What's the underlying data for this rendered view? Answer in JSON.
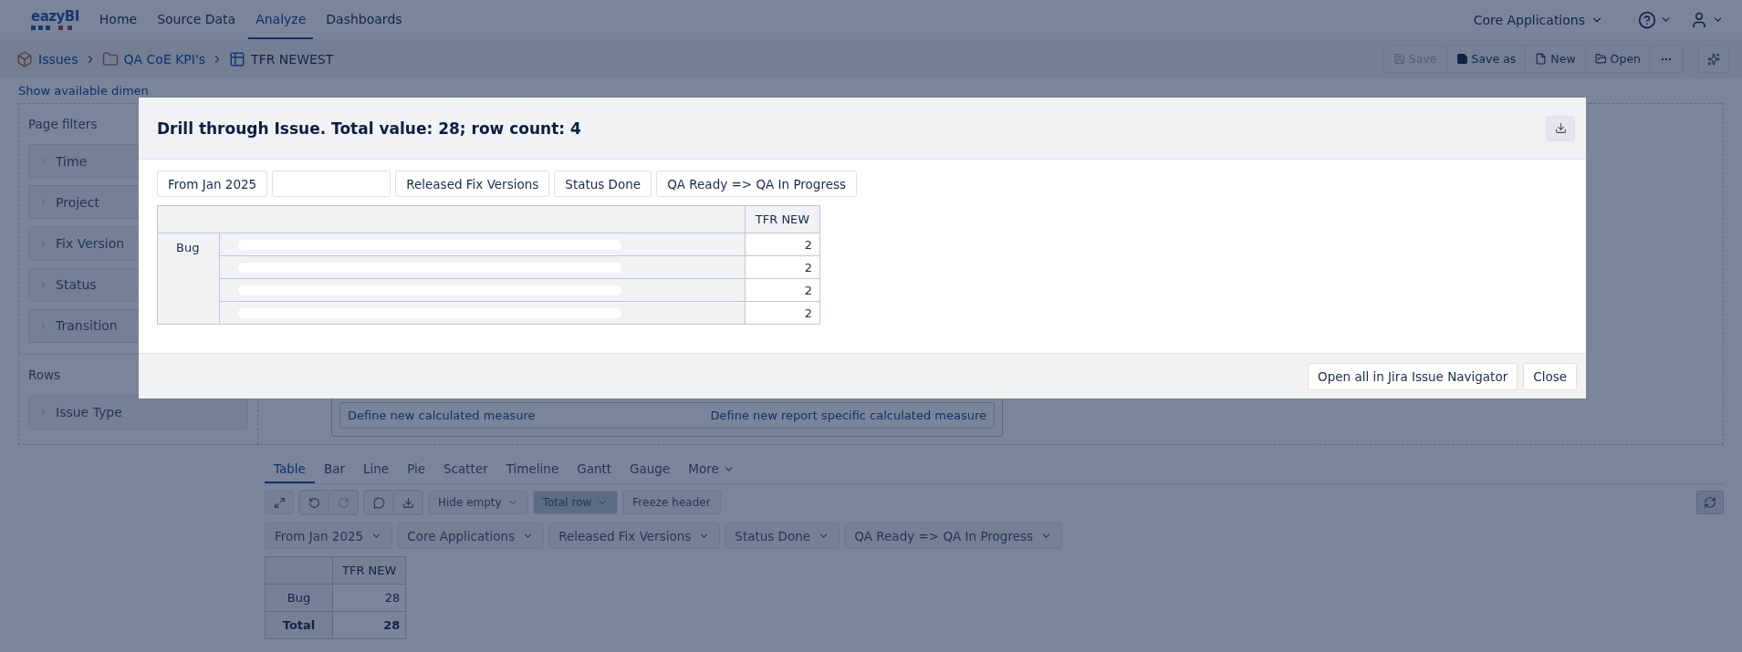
{
  "logo": {
    "text": "eazyBI"
  },
  "nav": [
    {
      "label": "Home",
      "selected": false
    },
    {
      "label": "Source Data",
      "selected": false
    },
    {
      "label": "Analyze",
      "selected": true
    },
    {
      "label": "Dashboards",
      "selected": false
    }
  ],
  "account": {
    "label": "Core Applications"
  },
  "breadcrumb": [
    {
      "label": "Issues",
      "kind": "cube",
      "link": true
    },
    {
      "label": "QA CoE KPI's",
      "kind": "folder",
      "link": true
    },
    {
      "label": "TFR NEWEST",
      "kind": "table",
      "link": false
    }
  ],
  "report_actions": [
    {
      "label": "Save",
      "kind": "save",
      "disabled": true
    },
    {
      "label": "Save as",
      "kind": "saveas",
      "disabled": false
    },
    {
      "label": "New",
      "kind": "new",
      "disabled": false
    },
    {
      "label": "Open",
      "kind": "open",
      "disabled": false
    }
  ],
  "dimensions_link": "Show available dimen",
  "page_filters": {
    "title": "Page filters",
    "items": [
      "Time",
      "Project",
      "Fix Version",
      "Status",
      "Transition"
    ]
  },
  "rows": {
    "title": "Rows",
    "items": [
      "Issue Type"
    ]
  },
  "measure_links": [
    "Define new calculated measure",
    "Define new report specific calculated measure"
  ],
  "view_tabs": [
    {
      "label": "Table",
      "selected": true
    },
    {
      "label": "Bar",
      "selected": false
    },
    {
      "label": "Line",
      "selected": false
    },
    {
      "label": "Pie",
      "selected": false
    },
    {
      "label": "Scatter",
      "selected": false
    },
    {
      "label": "Timeline",
      "selected": false
    },
    {
      "label": "Gantt",
      "selected": false
    },
    {
      "label": "Gauge",
      "selected": false
    },
    {
      "label": "More",
      "selected": false,
      "dropdown": true
    }
  ],
  "toolbar": [
    {
      "label": "Hide empty",
      "pressed": false,
      "dropdown": true
    },
    {
      "label": "Total row",
      "pressed": true,
      "dropdown": true
    },
    {
      "label": "Freeze header",
      "pressed": false,
      "dropdown": false
    }
  ],
  "filters": [
    "From Jan 2025",
    "Core Applications",
    "Released Fix Versions",
    "Status Done",
    "QA Ready => QA In Progress"
  ],
  "result_table": {
    "column": "TFR NEW",
    "rows": [
      {
        "label": "Bug",
        "value": "28",
        "total": false
      },
      {
        "label": "Total",
        "value": "28",
        "total": true
      }
    ]
  },
  "dialog": {
    "title": "Drill through Issue. Total value: 28; row count: 4",
    "chips": [
      {
        "kind": "text",
        "label": "From Jan 2025"
      },
      {
        "kind": "blank"
      },
      {
        "kind": "text",
        "label": "Released Fix Versions"
      },
      {
        "kind": "text",
        "label": "Status Done"
      },
      {
        "kind": "text",
        "label": "QA Ready => QA In Progress"
      }
    ],
    "column": "TFR NEW",
    "group": "Bug",
    "rows": [
      {
        "redacted": true,
        "value": "2"
      },
      {
        "redacted": true,
        "value": "2"
      },
      {
        "redacted": true,
        "value": "2"
      },
      {
        "redacted": true,
        "value": "2"
      }
    ],
    "buttons": [
      "Open all in Jira Issue Navigator",
      "Close"
    ]
  }
}
